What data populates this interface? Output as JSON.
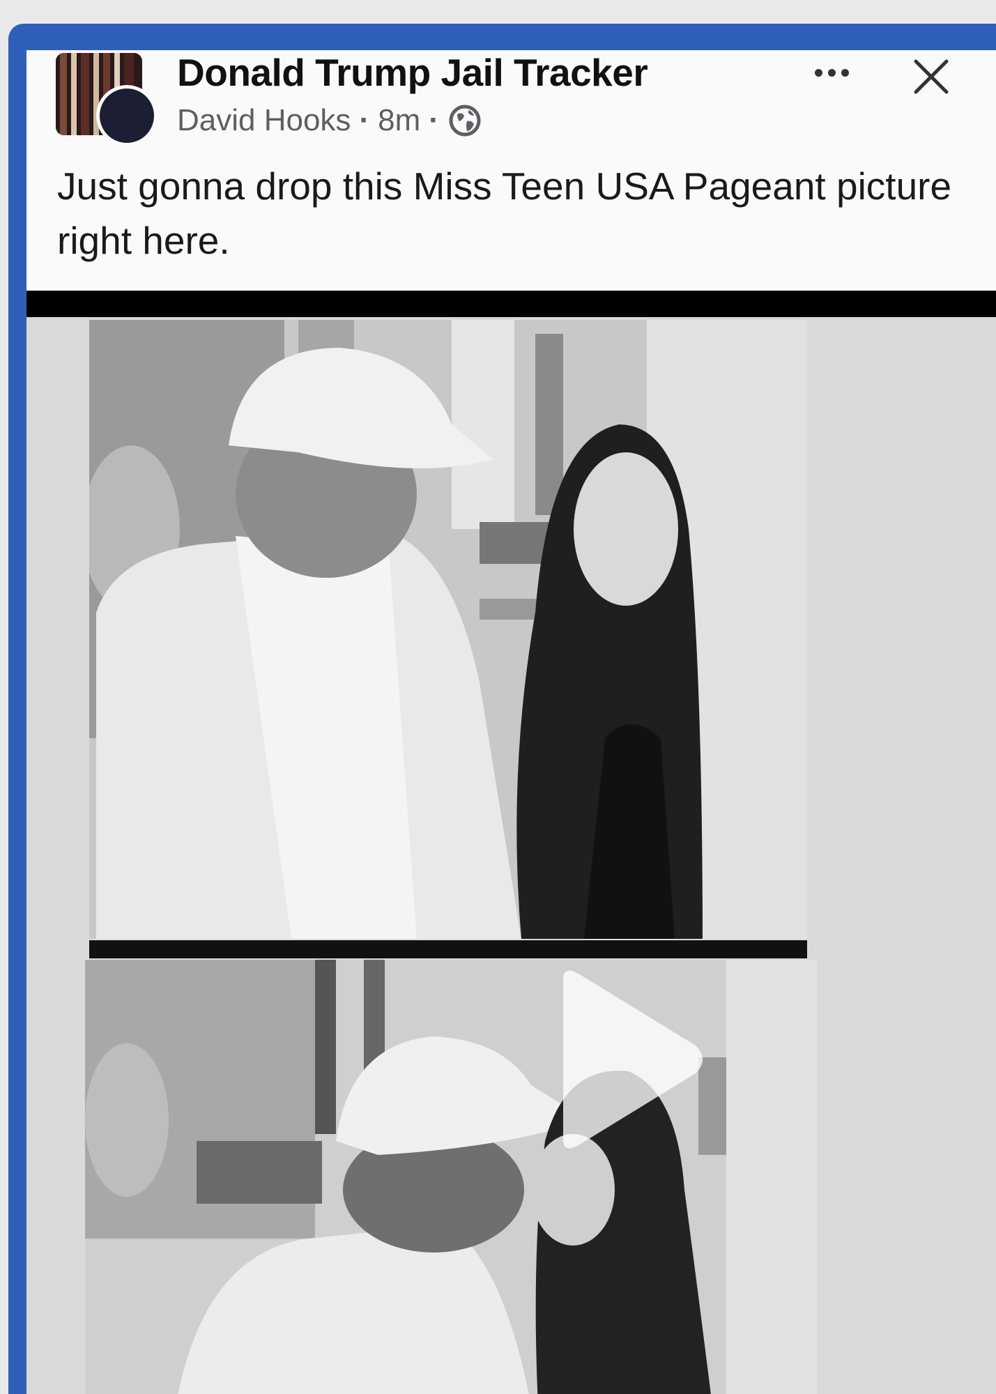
{
  "post": {
    "group_name": "Donald Trump Jail Tracker",
    "author": "David Hooks",
    "separator": "·",
    "time_ago": "8m",
    "audience_icon": "globe-icon",
    "text": "Just gonna drop this Miss Teen USA Pageant picture right here."
  },
  "header_actions": {
    "more_icon": "more-options-icon",
    "close_icon": "close-icon"
  },
  "media": {
    "type": "video",
    "play_icon": "play-icon",
    "photo_style": "black-and-white"
  },
  "colors": {
    "frame_blue": "#2f5fb8",
    "text_primary": "#111111",
    "text_secondary": "#5c5f64",
    "bar": "#000000"
  }
}
